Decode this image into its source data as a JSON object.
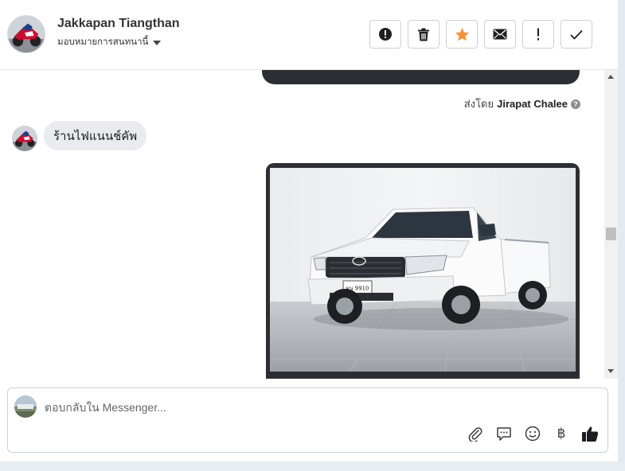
{
  "header": {
    "contact_name": "Jakkapan Tiangthan",
    "assign_label": "มอบหมายการสนทนานี้",
    "actions": [
      {
        "name": "spam-button",
        "icon": "alert-circle-icon"
      },
      {
        "name": "delete-button",
        "icon": "trash-icon"
      },
      {
        "name": "star-button",
        "icon": "star-icon",
        "color": "#f7923a"
      },
      {
        "name": "mark-unread-button",
        "icon": "envelope-icon"
      },
      {
        "name": "follow-up-button",
        "icon": "exclamation-icon"
      },
      {
        "name": "done-button",
        "icon": "check-icon"
      }
    ]
  },
  "thread": {
    "sent_by_prefix": "ส่งโดย",
    "sent_by_name": "Jirapat Chalee",
    "sent_by_help": "?",
    "incoming_message": "ร้านไฟแนนช์คัพ",
    "image_message": {
      "subject": "white pickup truck photo",
      "plate_text": "ผน 9910"
    }
  },
  "composer": {
    "placeholder": "ตอบกลับใน Messenger...",
    "tools": [
      "paperclip-icon",
      "saved-reply-icon",
      "emoji-icon",
      "baht-icon",
      "thumbs-up-icon"
    ],
    "baht_symbol": "฿"
  },
  "colors": {
    "accent_star": "#f7923a",
    "bubble_dark": "#2b2f33",
    "bubble_light": "#e9ebee"
  }
}
